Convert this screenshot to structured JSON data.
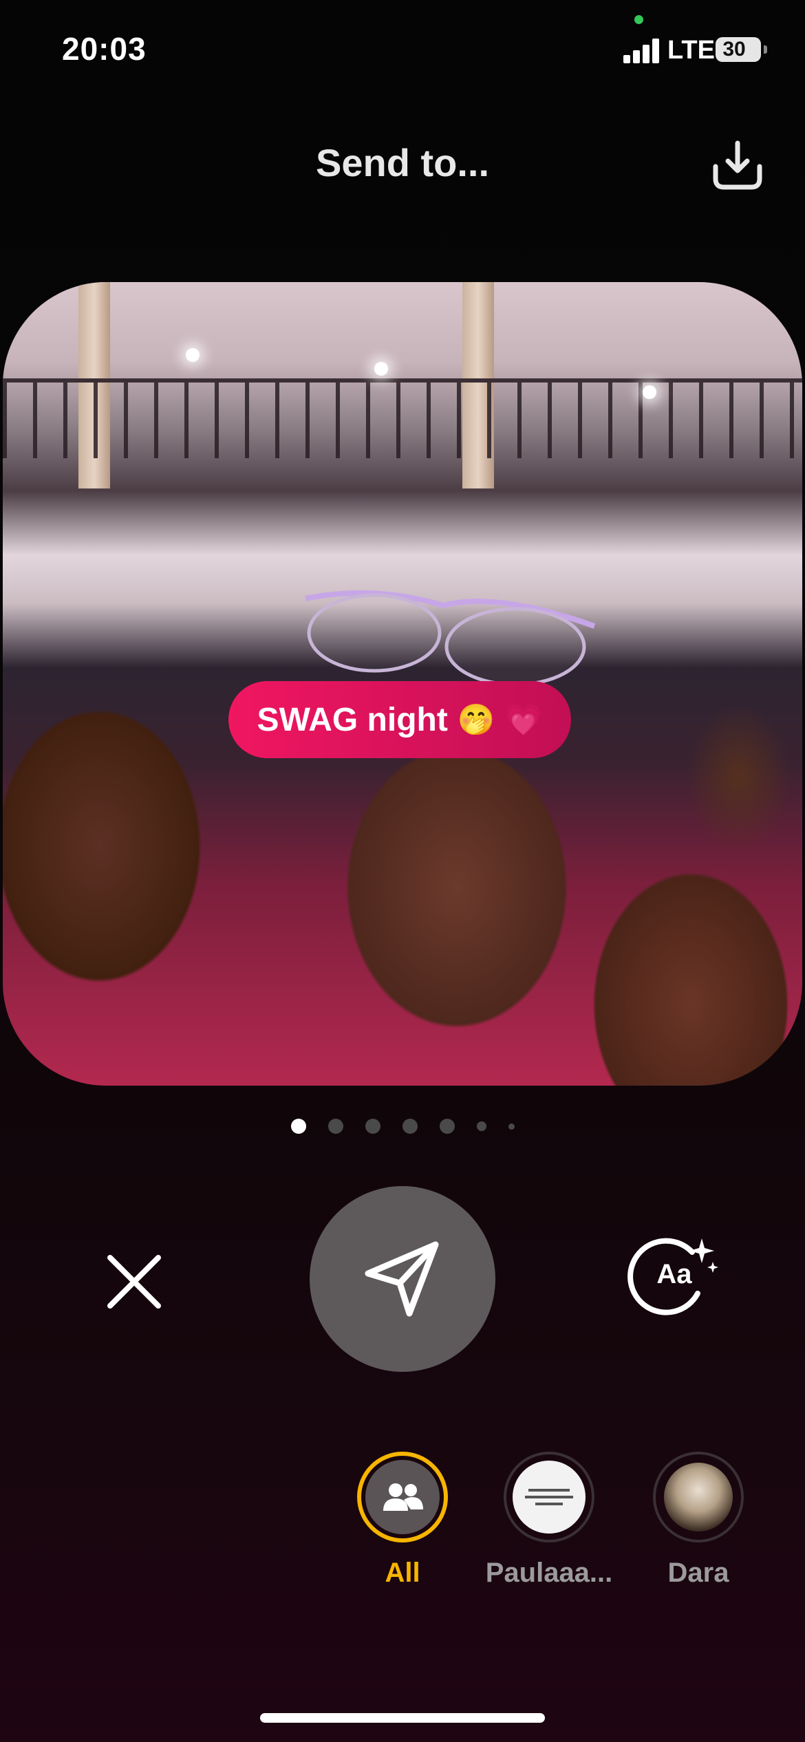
{
  "status_bar": {
    "time": "20:03",
    "network": "LTE",
    "battery": "30",
    "signal_bars": 4,
    "icons": [
      "signal-icon",
      "battery-icon"
    ]
  },
  "header": {
    "title": "Send to...",
    "download_icon": "download-icon"
  },
  "preview": {
    "sticker_text": "SWAG night",
    "sticker_emojis": [
      "🤭",
      "💗"
    ],
    "sticker_color": "#f01660"
  },
  "pagination": {
    "total": 7,
    "active_index": 0
  },
  "actions": {
    "close_icon": "close-icon",
    "send_icon": "send-icon",
    "text_effect_icon": "text-effect-icon",
    "text_effect_label": "Aa"
  },
  "recipients": [
    {
      "label": "All",
      "selected": true,
      "icon": "group-icon"
    },
    {
      "label": "Paulaaa...",
      "selected": false
    },
    {
      "label": "Dara",
      "selected": false
    }
  ],
  "colors": {
    "accent": "#f7b500",
    "send_button": "#5e5a5b",
    "background": "#050505"
  }
}
